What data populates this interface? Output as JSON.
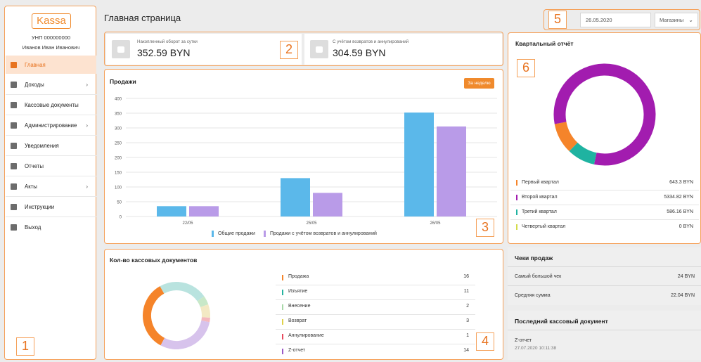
{
  "sidebar": {
    "logo": "Kassa",
    "unp": "УНП 000000000",
    "user_name": "Иванов Иван Иванович",
    "items": [
      {
        "label": "Главная",
        "active": true,
        "chevron": ""
      },
      {
        "label": "Доходы",
        "chevron": "›"
      },
      {
        "label": "Кассовые документы",
        "chevron": ""
      },
      {
        "label": "Администрирование",
        "chevron": "›"
      },
      {
        "label": "Уведомления",
        "chevron": ""
      },
      {
        "label": "Отчеты",
        "chevron": ""
      },
      {
        "label": "Акты",
        "chevron": "›"
      },
      {
        "label": "Инструкции",
        "chevron": ""
      },
      {
        "label": "Выход",
        "chevron": ""
      }
    ]
  },
  "header": {
    "title": "Главная страница",
    "date": "26.05.2020",
    "shops": "Магазины"
  },
  "stats": {
    "accumulated_label": "Накопленный оборот за сутки",
    "accumulated_value": "352.59 BYN",
    "net_label": "С учётом возвратов и аннулирований",
    "net_value": "304.59 BYN"
  },
  "sales": {
    "title": "Продажи",
    "week_button": "За неделю",
    "legend_total": "Общие продажи",
    "legend_net": "Продажи с учётом возвратов и аннулирований"
  },
  "docs": {
    "title": "Кол-во кассовых документов",
    "rows": [
      {
        "label": "Продажа",
        "value": "16",
        "color": "#f5842a"
      },
      {
        "label": "Изъятие",
        "value": "11",
        "color": "#26b3a0"
      },
      {
        "label": "Внесение",
        "value": "2",
        "color": "#a8d8a8"
      },
      {
        "label": "Возврат",
        "value": "3",
        "color": "#e0d14a"
      },
      {
        "label": "Аннулирование",
        "value": "1",
        "color": "#e84a5f"
      },
      {
        "label": "Z-отчет",
        "value": "14",
        "color": "#9b59c7"
      }
    ],
    "donut": [
      {
        "value": 16,
        "color": "#f5842a"
      },
      {
        "value": 11,
        "color": "#b9e3df"
      },
      {
        "value": 2,
        "color": "#c8e8c8"
      },
      {
        "value": 3,
        "color": "#f3e9c4"
      },
      {
        "value": 1,
        "color": "#f4b8be"
      },
      {
        "value": 14,
        "color": "#d7c3ec"
      }
    ]
  },
  "quarter": {
    "title": "Квартальный отчёт",
    "rows": [
      {
        "label": "Первый квартал",
        "value": "643.3 BYN",
        "color": "#f5842a"
      },
      {
        "label": "Второй квартал",
        "value": "5334.82 BYN",
        "color": "#a21caf"
      },
      {
        "label": "Третий квартал",
        "value": "586.16 BYN",
        "color": "#1fb3a1"
      },
      {
        "label": "Четвертый квартал",
        "value": "0 BYN",
        "color": "#d4dc4a"
      }
    ]
  },
  "receipts": {
    "title": "Чеки продаж",
    "largest_label": "Самый большой чек",
    "largest_value": "24 BYN",
    "average_label": "Средняя сумма",
    "average_value": "22.04 BYN"
  },
  "last_doc": {
    "title": "Последний кассовый документ",
    "name": "Z-отчет",
    "time": "27.07.2020 10:11:38"
  },
  "annotations": [
    "1",
    "2",
    "3",
    "4",
    "5",
    "6"
  ],
  "chart_data": [
    {
      "type": "bar",
      "title": "Продажи",
      "categories": [
        "22/05",
        "25/05",
        "26/05"
      ],
      "ylim": [
        0,
        400
      ],
      "yticks": [
        0,
        50,
        100,
        150,
        200,
        250,
        300,
        350,
        400
      ],
      "grid": true,
      "legend": "bottom",
      "series": [
        {
          "name": "Общие продажи",
          "color": "#5bb8ea",
          "values": [
            35,
            130,
            352
          ]
        },
        {
          "name": "Продажи с учётом возвратов и аннулирований",
          "color": "#b99be8",
          "values": [
            35,
            80,
            305
          ]
        }
      ]
    },
    {
      "type": "pie",
      "title": "Квартальный отчёт",
      "labels": [
        "Первый квартал",
        "Второй квартал",
        "Третий квартал",
        "Четвертый квартал"
      ],
      "values": [
        643.3,
        5334.82,
        586.16,
        0
      ],
      "colors": [
        "#f5842a",
        "#a21caf",
        "#1fb3a1",
        "#d4dc4a"
      ]
    }
  ]
}
